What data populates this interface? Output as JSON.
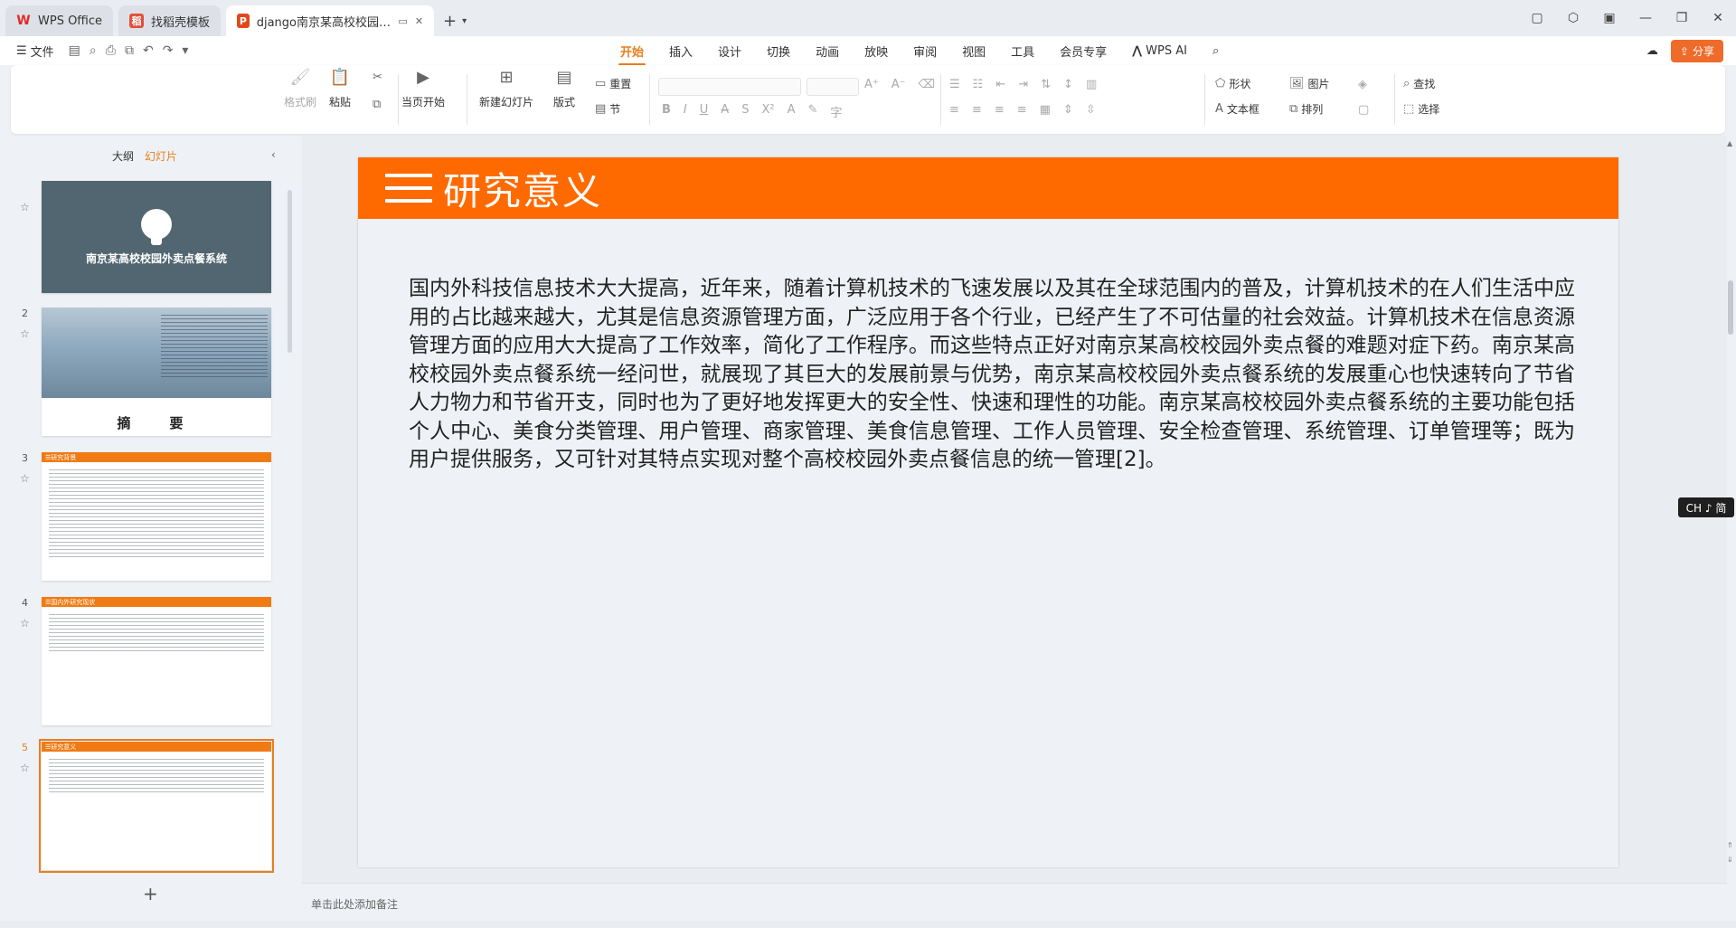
{
  "tabs": [
    {
      "label": "WPS Office",
      "icon": "wps-logo-icon"
    },
    {
      "label": "找稻壳模板",
      "icon": "docer-icon"
    },
    {
      "label": "django南京某高校校园外卖…",
      "icon": "presentation-icon"
    }
  ],
  "menu": {
    "file_label": "文件",
    "ribbon_tabs": [
      "开始",
      "插入",
      "设计",
      "切换",
      "动画",
      "放映",
      "审阅",
      "视图",
      "工具",
      "会员专享"
    ],
    "active_tab": "开始",
    "ai_label": "WPS AI",
    "share_label": "分享"
  },
  "toolbar": {
    "format_painter": "格式刷",
    "paste": "粘贴",
    "play_from_current": "当页开始",
    "new_slide": "新建幻灯片",
    "layout": "版式",
    "reset": "重置",
    "section": "节",
    "shape": "形状",
    "picture": "图片",
    "textbox": "文本框",
    "arrange": "排列",
    "find": "查找",
    "select": "选择"
  },
  "slide_pane": {
    "tab_outline": "大纲",
    "tab_slides": "幻灯片",
    "slides": [
      {
        "number": "",
        "title": "南京某高校校园外卖点餐系统"
      },
      {
        "number": "2",
        "title": "摘　要"
      },
      {
        "number": "3",
        "header": "研究背景"
      },
      {
        "number": "4",
        "header": "国内外研究现状"
      },
      {
        "number": "5",
        "header": "研究意义"
      }
    ]
  },
  "slide": {
    "title": "研究意义",
    "body": "国内外科技信息技术大大提高，近年来，随着计算机技术的飞速发展以及其在全球范围内的普及，计算机技术的在人们生活中应用的占比越来越大，尤其是信息资源管理方面，广泛应用于各个行业，已经产生了不可估量的社会效益。计算机技术在信息资源管理方面的应用大大提高了工作效率，简化了工作程序。而这些特点正好对南京某高校校园外卖点餐的难题对症下药。南京某高校校园外卖点餐系统一经问世，就展现了其巨大的发展前景与优势，南京某高校校园外卖点餐系统的发展重心也快速转向了节省人力物力和节省开支，同时也为了更好地发挥更大的安全性、快速和理性的功能。南京某高校校园外卖点餐系统的主要功能包括个人中心、美食分类管理、用户管理、商家管理、美食信息管理、工作人员管理、安全检查管理、系统管理、订单管理等；既为用户提供服务，又可针对其特点实现对整个高校校园外卖点餐信息的统一管理[2]。",
    "header_color": "#ff6a00"
  },
  "notes_placeholder": "单击此处添加备注",
  "ime": "CH ♪ 简",
  "colors": {
    "accent": "#e87f1f",
    "share": "#ef6b2a"
  }
}
